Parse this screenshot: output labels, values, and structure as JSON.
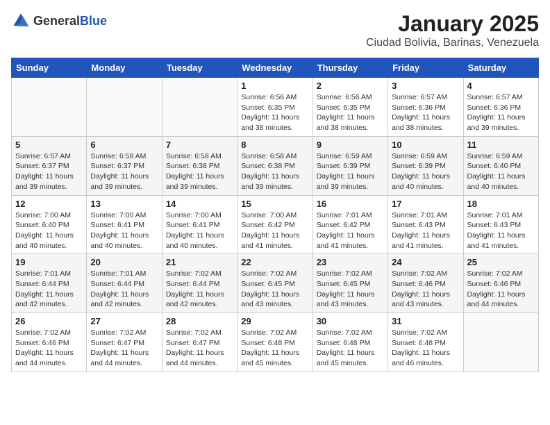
{
  "header": {
    "logo_general": "General",
    "logo_blue": "Blue",
    "title": "January 2025",
    "subtitle": "Ciudad Bolivia, Barinas, Venezuela"
  },
  "days_of_week": [
    "Sunday",
    "Monday",
    "Tuesday",
    "Wednesday",
    "Thursday",
    "Friday",
    "Saturday"
  ],
  "weeks": [
    [
      {
        "day": "",
        "info": ""
      },
      {
        "day": "",
        "info": ""
      },
      {
        "day": "",
        "info": ""
      },
      {
        "day": "1",
        "info": "Sunrise: 6:56 AM\nSunset: 6:35 PM\nDaylight: 11 hours and 38 minutes."
      },
      {
        "day": "2",
        "info": "Sunrise: 6:56 AM\nSunset: 6:35 PM\nDaylight: 11 hours and 38 minutes."
      },
      {
        "day": "3",
        "info": "Sunrise: 6:57 AM\nSunset: 6:36 PM\nDaylight: 11 hours and 38 minutes."
      },
      {
        "day": "4",
        "info": "Sunrise: 6:57 AM\nSunset: 6:36 PM\nDaylight: 11 hours and 39 minutes."
      }
    ],
    [
      {
        "day": "5",
        "info": "Sunrise: 6:57 AM\nSunset: 6:37 PM\nDaylight: 11 hours and 39 minutes."
      },
      {
        "day": "6",
        "info": "Sunrise: 6:58 AM\nSunset: 6:37 PM\nDaylight: 11 hours and 39 minutes."
      },
      {
        "day": "7",
        "info": "Sunrise: 6:58 AM\nSunset: 6:38 PM\nDaylight: 11 hours and 39 minutes."
      },
      {
        "day": "8",
        "info": "Sunrise: 6:58 AM\nSunset: 6:38 PM\nDaylight: 11 hours and 39 minutes."
      },
      {
        "day": "9",
        "info": "Sunrise: 6:59 AM\nSunset: 6:39 PM\nDaylight: 11 hours and 39 minutes."
      },
      {
        "day": "10",
        "info": "Sunrise: 6:59 AM\nSunset: 6:39 PM\nDaylight: 11 hours and 40 minutes."
      },
      {
        "day": "11",
        "info": "Sunrise: 6:59 AM\nSunset: 6:40 PM\nDaylight: 11 hours and 40 minutes."
      }
    ],
    [
      {
        "day": "12",
        "info": "Sunrise: 7:00 AM\nSunset: 6:40 PM\nDaylight: 11 hours and 40 minutes."
      },
      {
        "day": "13",
        "info": "Sunrise: 7:00 AM\nSunset: 6:41 PM\nDaylight: 11 hours and 40 minutes."
      },
      {
        "day": "14",
        "info": "Sunrise: 7:00 AM\nSunset: 6:41 PM\nDaylight: 11 hours and 40 minutes."
      },
      {
        "day": "15",
        "info": "Sunrise: 7:00 AM\nSunset: 6:42 PM\nDaylight: 11 hours and 41 minutes."
      },
      {
        "day": "16",
        "info": "Sunrise: 7:01 AM\nSunset: 6:42 PM\nDaylight: 11 hours and 41 minutes."
      },
      {
        "day": "17",
        "info": "Sunrise: 7:01 AM\nSunset: 6:43 PM\nDaylight: 11 hours and 41 minutes."
      },
      {
        "day": "18",
        "info": "Sunrise: 7:01 AM\nSunset: 6:43 PM\nDaylight: 11 hours and 41 minutes."
      }
    ],
    [
      {
        "day": "19",
        "info": "Sunrise: 7:01 AM\nSunset: 6:44 PM\nDaylight: 11 hours and 42 minutes."
      },
      {
        "day": "20",
        "info": "Sunrise: 7:01 AM\nSunset: 6:44 PM\nDaylight: 11 hours and 42 minutes."
      },
      {
        "day": "21",
        "info": "Sunrise: 7:02 AM\nSunset: 6:44 PM\nDaylight: 11 hours and 42 minutes."
      },
      {
        "day": "22",
        "info": "Sunrise: 7:02 AM\nSunset: 6:45 PM\nDaylight: 11 hours and 43 minutes."
      },
      {
        "day": "23",
        "info": "Sunrise: 7:02 AM\nSunset: 6:45 PM\nDaylight: 11 hours and 43 minutes."
      },
      {
        "day": "24",
        "info": "Sunrise: 7:02 AM\nSunset: 6:46 PM\nDaylight: 11 hours and 43 minutes."
      },
      {
        "day": "25",
        "info": "Sunrise: 7:02 AM\nSunset: 6:46 PM\nDaylight: 11 hours and 44 minutes."
      }
    ],
    [
      {
        "day": "26",
        "info": "Sunrise: 7:02 AM\nSunset: 6:46 PM\nDaylight: 11 hours and 44 minutes."
      },
      {
        "day": "27",
        "info": "Sunrise: 7:02 AM\nSunset: 6:47 PM\nDaylight: 11 hours and 44 minutes."
      },
      {
        "day": "28",
        "info": "Sunrise: 7:02 AM\nSunset: 6:47 PM\nDaylight: 11 hours and 44 minutes."
      },
      {
        "day": "29",
        "info": "Sunrise: 7:02 AM\nSunset: 6:48 PM\nDaylight: 11 hours and 45 minutes."
      },
      {
        "day": "30",
        "info": "Sunrise: 7:02 AM\nSunset: 6:48 PM\nDaylight: 11 hours and 45 minutes."
      },
      {
        "day": "31",
        "info": "Sunrise: 7:02 AM\nSunset: 6:48 PM\nDaylight: 11 hours and 46 minutes."
      },
      {
        "day": "",
        "info": ""
      }
    ]
  ]
}
